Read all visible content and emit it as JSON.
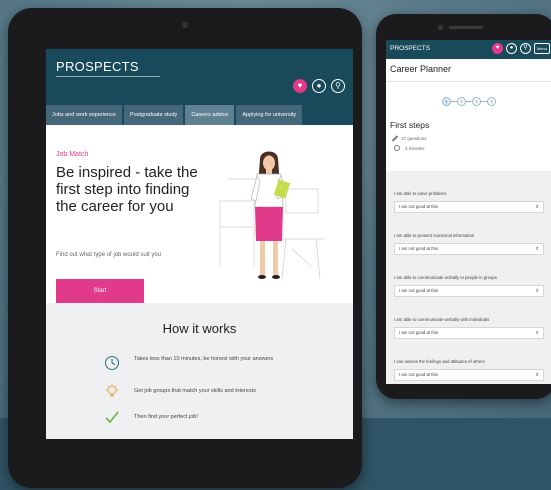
{
  "tablet": {
    "logo": "PROSPECTS",
    "tabs": [
      {
        "label": "Jobs and work experience"
      },
      {
        "label": "Postgraduate study"
      },
      {
        "label": "Careers advice"
      },
      {
        "label": "Applying for university"
      }
    ],
    "hero": {
      "kicker": "Job Match",
      "headline": "Be inspired - take the first step into finding the career for you",
      "sub": "Find out what type of job would suit you",
      "start_label": "Start"
    },
    "how": {
      "title": "How it works",
      "items": [
        {
          "text": "Takes less than 10 minutes, be honest with your answers",
          "icon": "clock-icon"
        },
        {
          "text": "Get job groups that match your skills and interests",
          "icon": "lightbulb-icon"
        },
        {
          "text": "Then find your perfect job!",
          "icon": "check-icon"
        }
      ]
    }
  },
  "phone": {
    "logo": "PROSPECTS",
    "menu_label": "Menu",
    "title": "Career Planner",
    "steps": [
      "1",
      "2",
      "3",
      "4"
    ],
    "section_title": "First steps",
    "meta": {
      "questions": "17 questions",
      "time": "3 minutes"
    },
    "questions": [
      {
        "label": "I am able to solve problems",
        "value": "I am not good at this"
      },
      {
        "label": "I am able to present numerical information",
        "value": "I am not good at this"
      },
      {
        "label": "I am able to communicate verbally to people in groups",
        "value": "I am not good at this"
      },
      {
        "label": "I am able to communicate verbally with individuals",
        "value": "I am not good at this"
      },
      {
        "label": "I can assess the feelings and attitudes of others",
        "value": "I am not good at this"
      }
    ]
  },
  "colors": {
    "brand": "#184a5b",
    "accent": "#e23a8a",
    "tab": "#44677a",
    "tab_active": "#5f8292"
  }
}
